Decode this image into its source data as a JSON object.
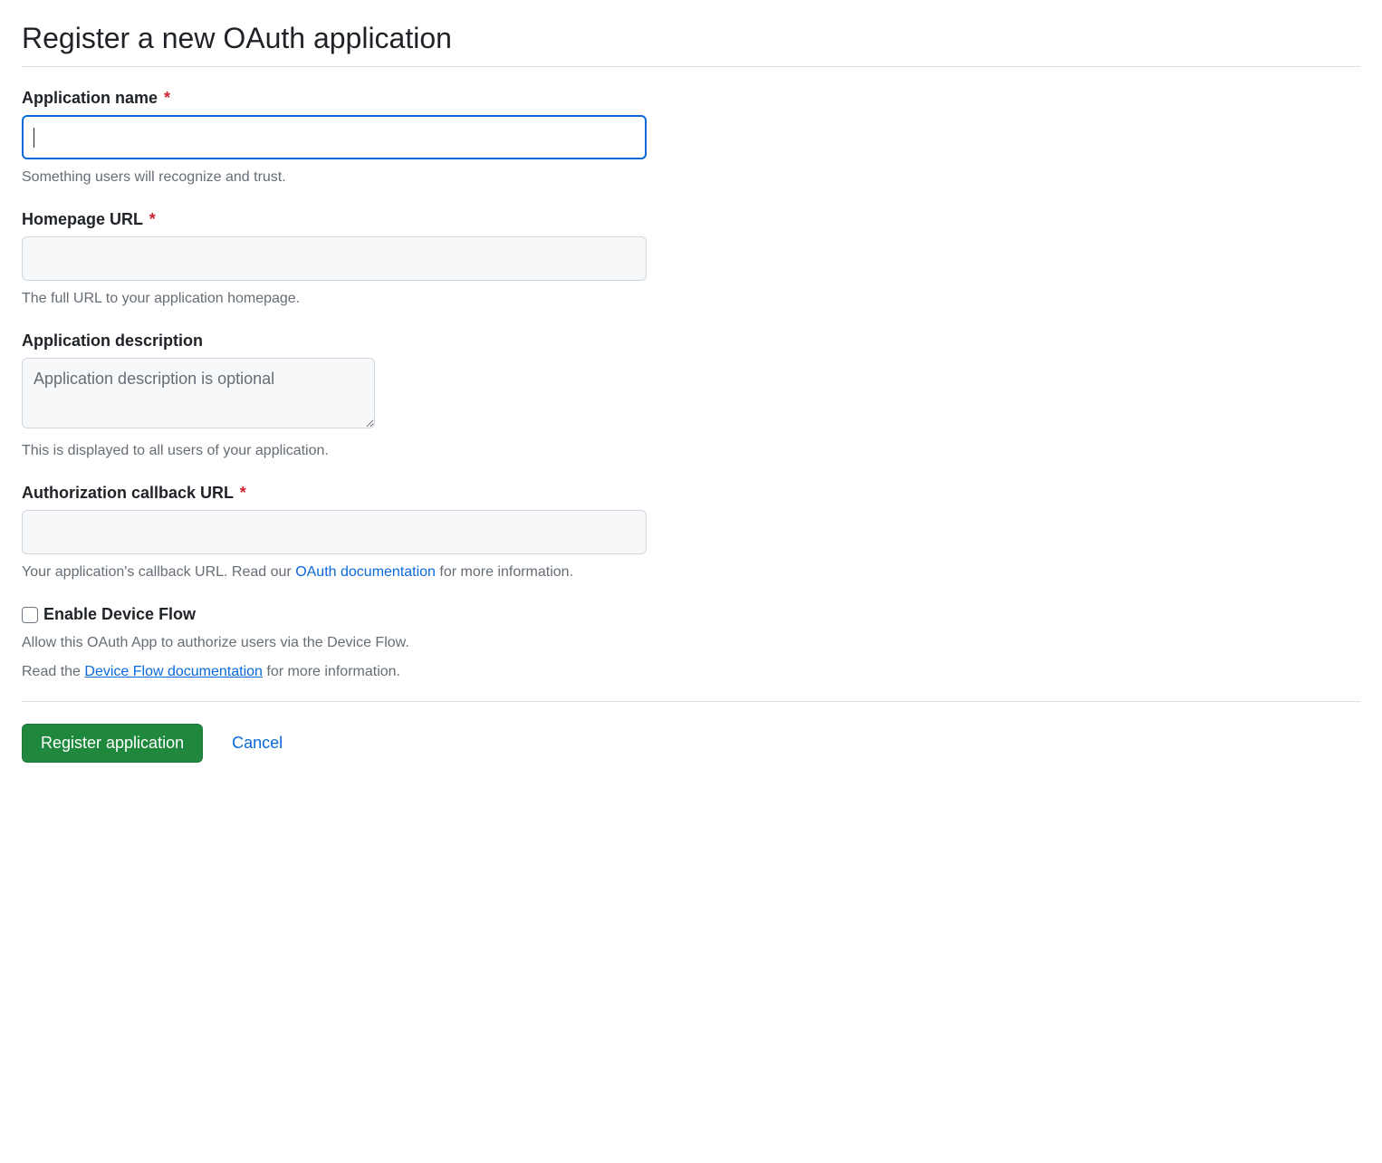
{
  "page": {
    "title": "Register a new OAuth application"
  },
  "form": {
    "app_name": {
      "label": "Application name",
      "value": "",
      "hint": "Something users will recognize and trust."
    },
    "homepage_url": {
      "label": "Homepage URL",
      "value": "",
      "hint": "The full URL to your application homepage."
    },
    "description": {
      "label": "Application description",
      "placeholder": "Application description is optional",
      "value": "",
      "hint": "This is displayed to all users of your application."
    },
    "callback_url": {
      "label": "Authorization callback URL",
      "value": "",
      "hint_pre": "Your application's callback URL. Read our ",
      "hint_link": "OAuth documentation",
      "hint_post": " for more information."
    },
    "device_flow": {
      "label": "Enable Device Flow",
      "hint1": "Allow this OAuth App to authorize users via the Device Flow.",
      "hint2_pre": "Read the ",
      "hint2_link": "Device Flow documentation",
      "hint2_post": " for more information."
    }
  },
  "buttons": {
    "submit": "Register application",
    "cancel": "Cancel"
  },
  "required_marker": "*"
}
